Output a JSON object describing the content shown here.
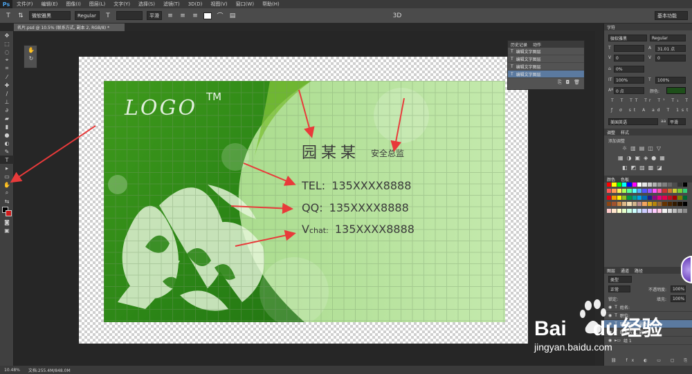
{
  "app": {
    "logo": "Ps"
  },
  "menu": [
    "文件(F)",
    "编辑(E)",
    "图像(I)",
    "图层(L)",
    "文字(Y)",
    "选择(S)",
    "滤镜(T)",
    "3D(D)",
    "视图(V)",
    "窗口(W)",
    "帮助(H)"
  ],
  "options": {
    "font_family": "微软雅黑",
    "font_style": "Regular",
    "size": "",
    "antialias": "平滑",
    "threeD": "3D",
    "workspace": "基本功能"
  },
  "document_tab": "名片.psd @ 10.5% (联系方式, 副本 2, RGB/8) *",
  "card": {
    "logo": "LOGO",
    "tm": "TM",
    "name": "园某某",
    "title": "安全总监",
    "tel_label": "TEL:",
    "tel": "135XXXX8888",
    "qq_label": "QQ:",
    "qq": "135XXXX8888",
    "vchat_label_big": "V",
    "vchat_label_small": "chat:",
    "vchat": "135XXXX8888",
    "colors": {
      "dark_green": "#2f8a18",
      "light_green": "#b5e29c"
    }
  },
  "history": {
    "tabs": [
      "历史记录",
      "动作"
    ],
    "items": [
      "编辑文字图层",
      "编辑文字图层",
      "编辑文字图层",
      "编辑文字图层"
    ],
    "selected_index": 3
  },
  "character": {
    "tab": "字符",
    "font_family": "微软雅黑",
    "font_style": "Regular",
    "size": "",
    "leading": "31.01 点",
    "kerning": "0",
    "tracking": "0",
    "scale_percent": "0%",
    "vscale": "100%",
    "hscale": "100%",
    "baseline": "0 点",
    "color_label": "颜色:",
    "language": "美国英语",
    "antialias": "平滑"
  },
  "adjustments": {
    "tabs": [
      "调整",
      "样式"
    ],
    "hint": "添加调整"
  },
  "swatches_panel": {
    "tabs": [
      "颜色",
      "色板"
    ]
  },
  "layers": {
    "tabs": [
      "图层",
      "通道",
      "路径"
    ],
    "filter": "类型",
    "blend": "正常",
    "opacity_label": "不透明度:",
    "opacity": "100%",
    "lock_label": "锁定:",
    "fill_label": "填充:",
    "fill": "100%",
    "rows": [
      {
        "name": "姓名:"
      },
      {
        "name": "职位:"
      },
      {
        "name": "联系方式, 副本 2"
      },
      {
        "name": "联系方式, 副本"
      },
      {
        "name": "组 1"
      }
    ]
  },
  "status": {
    "zoom": "10.48%",
    "doc": "文档:255.4M/848.0M"
  },
  "watermark": {
    "brand": "Bai",
    "paw": "du",
    "cn": "经验",
    "url": "jingyan.baidu.com"
  }
}
